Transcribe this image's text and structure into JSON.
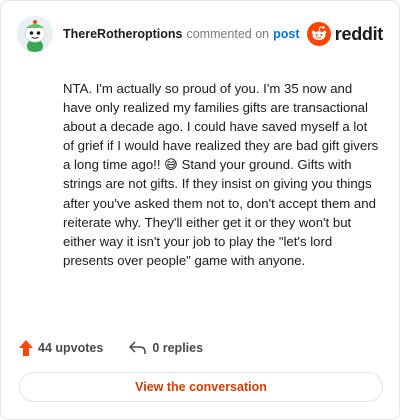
{
  "header": {
    "username": "ThereRotheroptions",
    "commented_text": "commented on",
    "post_link": "post",
    "brand": "reddit"
  },
  "comment": {
    "text": "NTA. I'm actually so proud of you. I'm 35 now and have only realized my families gifts are transactional about a decade ago. I could have saved myself a lot of grief if I would have realized they are bad gift givers a long time ago!! 😅 Stand your ground. Gifts with strings are not gifts. If they insist on giving you things after you've asked them not to, don't accept them and reiterate why. They'll either get it or they won't but either way it isn't your job to play the \"let's lord presents over people\" game with anyone."
  },
  "actions": {
    "upvotes": "44 upvotes",
    "replies": "0 replies"
  },
  "footer": {
    "view_conversation": "View the conversation"
  },
  "colors": {
    "link": "#0079d3",
    "brand_orange": "#ff4500",
    "cta": "#d93a00"
  },
  "icons": [
    "avatar-snoo",
    "reddit-logo-icon",
    "upvote-arrow-icon",
    "reply-arrow-icon"
  ]
}
